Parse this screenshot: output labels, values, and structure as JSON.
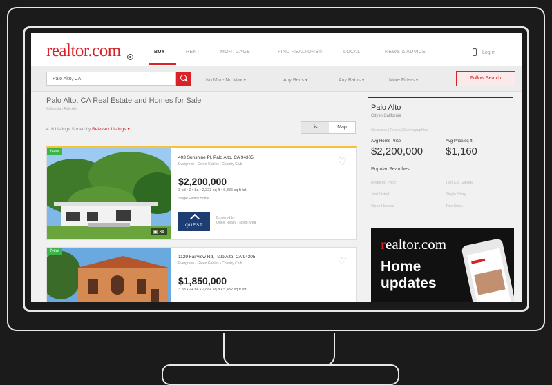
{
  "nav": {
    "logo": "realtor.com",
    "items": [
      "BUY",
      "RENT",
      "MORTGAGE",
      "FIND REALTORS®",
      "LOCAL",
      "NEWS & ADVICE"
    ],
    "login": "Log in"
  },
  "search": {
    "value": "Palo Alto, CA",
    "filters": [
      "No Min - No Max ▾",
      "Any Beds ▾",
      "Any Baths ▾",
      "More Filters ▾"
    ],
    "follow": "Follow Search"
  },
  "results": {
    "title": "Palo Alto, CA Real Estate and Homes for Sale",
    "breadcrumb": "California › Palo Alto",
    "sorted_prefix": "416 Listings Sorted by",
    "sorted_link": "Relevant Listings ▾",
    "list": "List",
    "map": "Map"
  },
  "listings": [
    {
      "badge": "New",
      "address": "403 Sunshine Pl, Palo Alto, CA 94305",
      "neighborhood": "Evergreen • Green Gables • Country Club",
      "price": "$2,200,000",
      "specs": "3 bd • 2+ ba • 2,323 sq ft • 6,886 sq ft lot",
      "type": "Single Family Home",
      "photos": "▣ 34",
      "broker_logo": "QUEST",
      "brokered_1": "Brokered by",
      "brokered_2": "Quest Realty - North Area"
    },
    {
      "badge": "New",
      "address": "1129 Fairview Rd, Palo Alto, CA 94305",
      "neighborhood": "Evergreen • Green Gables • Country Club",
      "price": "$1,850,000",
      "specs": "3 bd • 2+ ba • 2,884 sq ft • 5,432 sq ft lot"
    }
  ],
  "sidebar": {
    "city": "Palo Alto",
    "city_sub": "City in California",
    "links": "Overview | Prices | Demographics",
    "avg_price_label": "Avg Home Price",
    "avg_price": "$2,200,000",
    "avg_sqft_label": "Avg Price/sq ft",
    "avg_sqft": "$1,160",
    "popular_title": "Popular Searches",
    "popular": [
      "Reduced Price",
      "Two Car Garage",
      "Just Listed",
      "Single Story",
      "Open Houses",
      "Two Story"
    ]
  },
  "ad": {
    "logo_r": "r",
    "logo_rest": "ealtor.com",
    "line1": "Home",
    "line2": "updates"
  },
  "colors": {
    "brand": "#d92228",
    "new_badge": "#3bb54a",
    "highlight": "#f5c23a"
  }
}
